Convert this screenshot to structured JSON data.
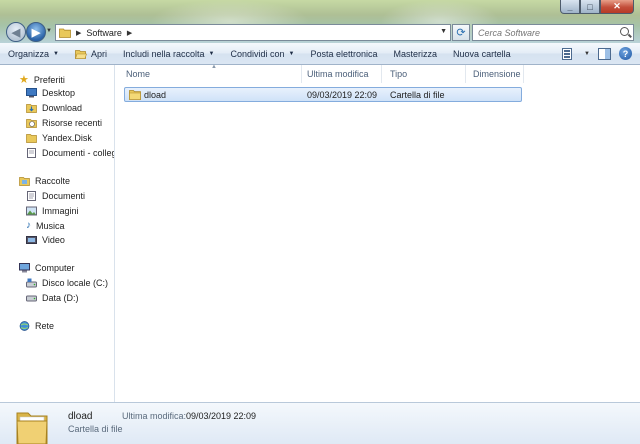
{
  "window": {
    "minimize_glyph": "_",
    "maximize_glyph": "□",
    "close_glyph": "✕"
  },
  "address_bar": {
    "path": [
      "Software"
    ],
    "folder_icon": "folder-icon"
  },
  "search": {
    "placeholder": "Cerca Software"
  },
  "toolbar": {
    "organize": "Organizza",
    "open": "Apri",
    "include": "Includi nella raccolta",
    "share": "Condividi con",
    "email": "Posta elettronica",
    "burn": "Masterizza",
    "new_folder": "Nuova cartella"
  },
  "sidebar": {
    "favorites_label": "Preferiti",
    "favorites": [
      "Desktop",
      "Download",
      "Risorse recenti",
      "Yandex.Disk",
      "Documenti - collega"
    ],
    "libraries_label": "Raccolte",
    "libraries": [
      "Documenti",
      "Immagini",
      "Musica",
      "Video"
    ],
    "computer_label": "Computer",
    "drives": [
      "Disco locale (C:)",
      "Data (D:)"
    ],
    "network_label": "Rete"
  },
  "file_list": {
    "columns": [
      "Nome",
      "Ultima modifica",
      "Tipo",
      "Dimensione"
    ],
    "rows": [
      {
        "name": "dload",
        "modified": "09/03/2019 22:09",
        "type": "Cartella di file",
        "size": ""
      }
    ]
  },
  "details_pane": {
    "name": "dload",
    "type": "Cartella di file",
    "modified_label": "Ultima modifica:",
    "modified_value": "09/03/2019 22:09"
  },
  "colors": {
    "selection_border": "#84acdd",
    "selection_fill": "#cfe2f8",
    "toolbar_bg": "#dbe6f3",
    "folder_yellow": "#e9c85a"
  }
}
